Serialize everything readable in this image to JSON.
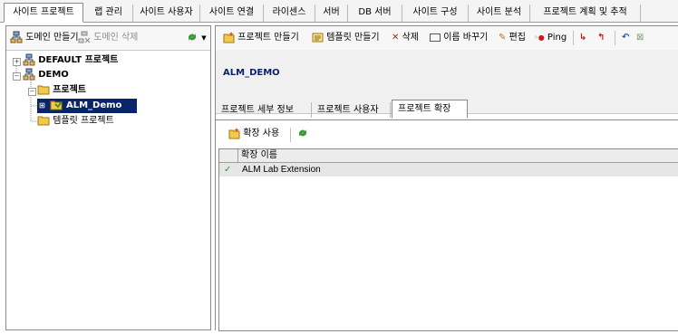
{
  "top_tabs": [
    {
      "label": "사이트 프로젝트",
      "active": true
    },
    {
      "label": "랩 관리"
    },
    {
      "label": "사이트 사용자"
    },
    {
      "label": "사이트 연결"
    },
    {
      "label": "라이센스"
    },
    {
      "label": "서버"
    },
    {
      "label": "DB 서버"
    },
    {
      "label": "사이트 구성"
    },
    {
      "label": "사이트 분석"
    },
    {
      "label": "프로젝트 계획 및 추적"
    }
  ],
  "left_toolbar": {
    "create_domain": "도메인 만들기",
    "delete_domain": "도메인 삭제"
  },
  "tree": {
    "default_project": "DEFAULT 프로젝트",
    "demo": "DEMO",
    "projects_folder": "프로젝트",
    "selected_project": "ALM_Demo",
    "template_projects": "템플릿 프로젝트"
  },
  "right_toolbar": {
    "create_project": "프로젝트 만들기",
    "create_template": "템플릿 만들기",
    "delete": "삭제",
    "rename": "이름 바꾸기",
    "edit": "편집",
    "ping": "Ping"
  },
  "project_header": {
    "title": "ALM_DEMO"
  },
  "sub_tabs": [
    {
      "label": "프로젝트 세부 정보"
    },
    {
      "label": "프로젝트 사용자"
    },
    {
      "label": "프로젝트 확장",
      "active": true
    }
  ],
  "extensions": {
    "enable_button": "확장 사용",
    "column_header": "확장 이름",
    "rows": [
      {
        "name": "ALM Lab Extension",
        "enabled": true
      }
    ]
  },
  "colors": {
    "selection": "#0a246a",
    "title": "#0a246a",
    "check": "#2e8b2e"
  }
}
